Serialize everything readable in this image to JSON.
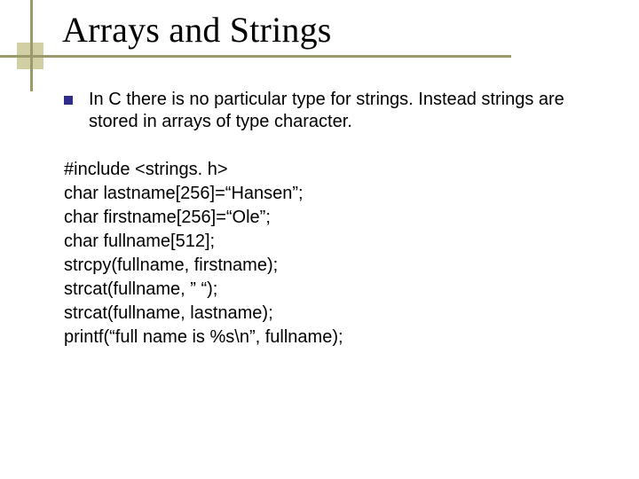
{
  "title": "Arrays and Strings",
  "bullet": "In C there is no particular type for strings. Instead strings are stored in arrays of type character.",
  "code": [
    "#include <strings. h>",
    "char lastname[256]=“Hansen”;",
    "char firstname[256]=“Ole”;",
    "char fullname[512];",
    "strcpy(fullname, firstname);",
    "strcat(fullname, ” “);",
    "strcat(fullname, lastname);",
    "printf(“full name is %s\\n”, fullname);"
  ]
}
